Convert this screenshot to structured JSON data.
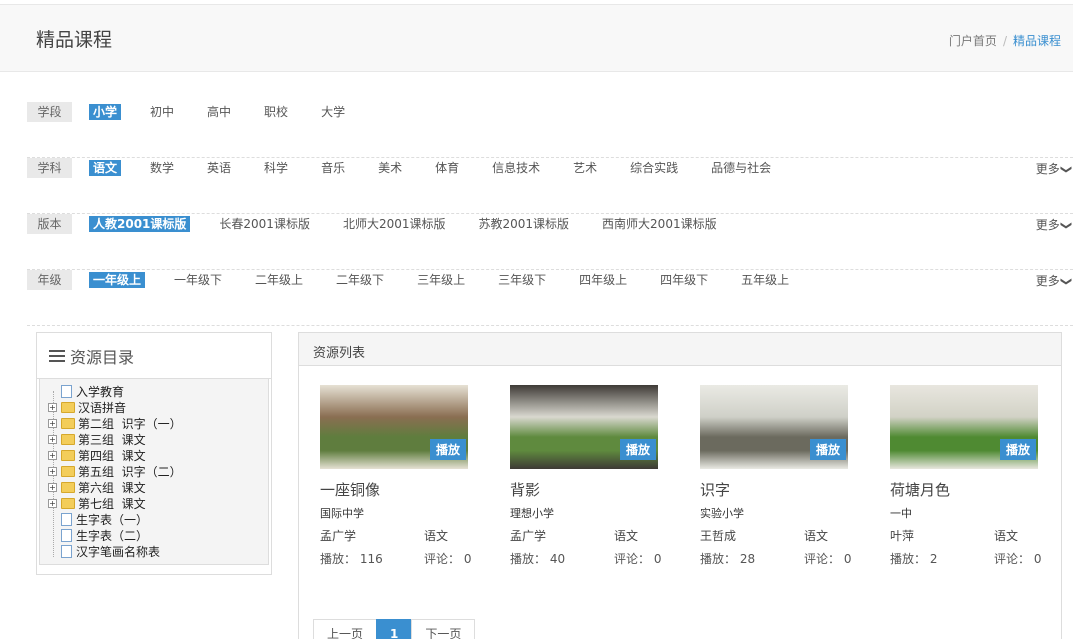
{
  "header": {
    "title": "精品课程",
    "breadcrumb": {
      "home": "门户首页",
      "separator": "/",
      "current": "精品课程"
    }
  },
  "filters": [
    {
      "label": "学段",
      "options": [
        "小学",
        "初中",
        "高中",
        "职校",
        "大学"
      ],
      "selected": 0,
      "more": ""
    },
    {
      "label": "学科",
      "options": [
        "语文",
        "数学",
        "英语",
        "科学",
        "音乐",
        "美术",
        "体育",
        "信息技术",
        "艺术",
        "综合实践",
        "品德与社会"
      ],
      "selected": 0,
      "more": "更多"
    },
    {
      "label": "版本",
      "options": [
        "人教2001课标版",
        "长春2001课标版",
        "北师大2001课标版",
        "苏教2001课标版",
        "西南师大2001课标版"
      ],
      "selected": 0,
      "more": "更多"
    },
    {
      "label": "年级",
      "options": [
        "一年级上",
        "一年级下",
        "二年级上",
        "二年级下",
        "三年级上",
        "三年级下",
        "四年级上",
        "四年级下",
        "五年级上"
      ],
      "selected": 0,
      "more": "更多"
    }
  ],
  "sidebar": {
    "title": "资源目录",
    "items": [
      {
        "label": "入学教育",
        "type": "file",
        "expandable": false
      },
      {
        "label": "汉语拼音",
        "type": "folder",
        "expandable": true
      },
      {
        "label": "第二组  识字（一）",
        "type": "folder",
        "expandable": true
      },
      {
        "label": "第三组  课文",
        "type": "folder",
        "expandable": true
      },
      {
        "label": "第四组  课文",
        "type": "folder",
        "expandable": true
      },
      {
        "label": "第五组  识字（二）",
        "type": "folder",
        "expandable": true
      },
      {
        "label": "第六组  课文",
        "type": "folder",
        "expandable": true
      },
      {
        "label": "第七组  课文",
        "type": "folder",
        "expandable": true
      },
      {
        "label": "生字表（一）",
        "type": "file",
        "expandable": false
      },
      {
        "label": "生字表（二）",
        "type": "file",
        "expandable": false
      },
      {
        "label": "汉字笔画名称表",
        "type": "file",
        "expandable": false
      }
    ]
  },
  "panel": {
    "title": "资源列表",
    "play_label": "播放",
    "plays_label": "播放：",
    "comments_label": "评论：",
    "cards": [
      {
        "title": "一座铜像",
        "school": "国际中学",
        "teacher": "孟广学",
        "subject": "语文",
        "plays": "116",
        "comments": "0",
        "palette": [
          "#8a6e52",
          "#5f7d3e",
          "#e6e1d4"
        ]
      },
      {
        "title": "背影",
        "school": "理想小学",
        "teacher": "孟广学",
        "subject": "语文",
        "plays": "40",
        "comments": "0",
        "palette": [
          "#d9d8cf",
          "#5f8a3e",
          "#3e3a36"
        ]
      },
      {
        "title": "识字",
        "school": "实验小学",
        "teacher": "王哲成",
        "subject": "语文",
        "plays": "28",
        "comments": "0",
        "palette": [
          "#cfd0c8",
          "#6b6a5e",
          "#eaeae4"
        ]
      },
      {
        "title": "荷塘月色",
        "school": "一中",
        "teacher": "叶萍",
        "subject": "语文",
        "plays": "2",
        "comments": "0",
        "palette": [
          "#d2d2c6",
          "#4f8a32",
          "#e8e6df"
        ]
      }
    ],
    "pager": {
      "prev": "上一页",
      "current": "1",
      "next": "下一页"
    }
  }
}
